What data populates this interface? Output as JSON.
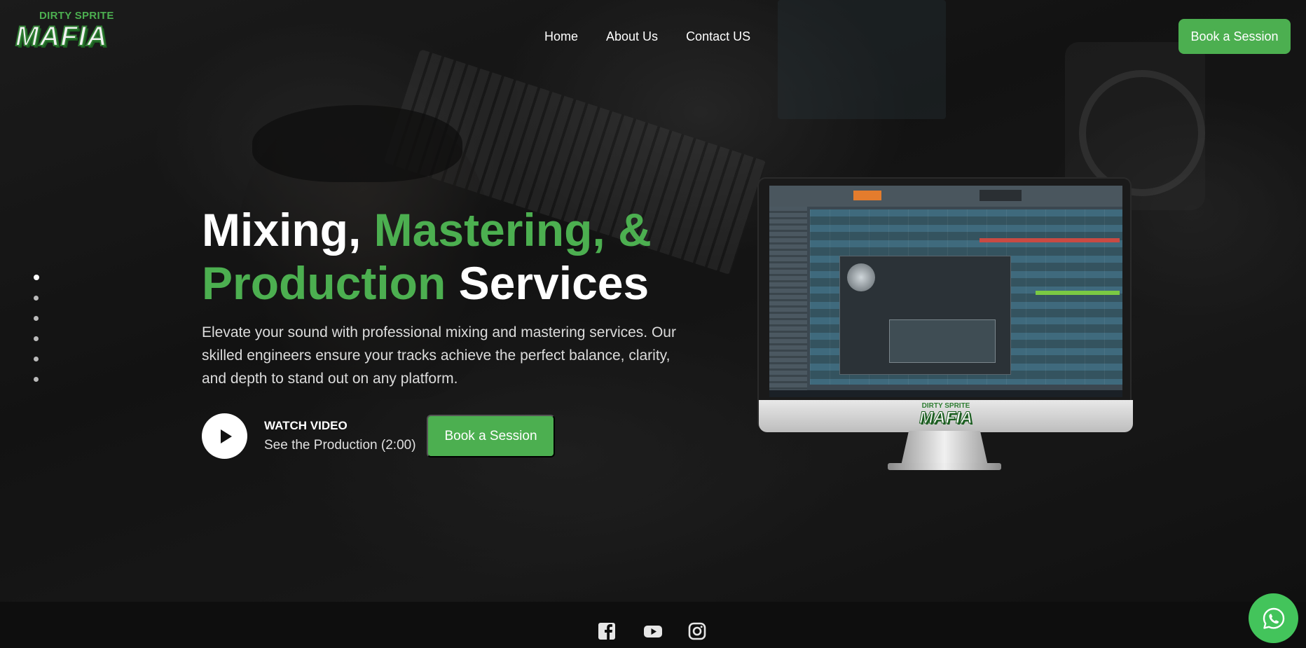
{
  "brand": {
    "logo_top": "DIRTY SPRITE",
    "logo_main": "MAFIA"
  },
  "nav": {
    "items": [
      "Home",
      "About Us",
      "Contact US"
    ]
  },
  "header": {
    "cta_label": "Book a Session"
  },
  "slider": {
    "dot_count": 6,
    "active_index": 0
  },
  "hero": {
    "headline_1": "Mixing, ",
    "headline_2": "Mastering, &",
    "headline_3": "Production",
    "headline_4": " Services",
    "description": "Elevate your sound with professional mixing and mastering services. Our skilled engineers ensure your tracks achieve the perfect balance, clarity, and depth to stand out on any platform.",
    "watch_label": "WATCH VIDEO",
    "watch_sub": "See the Production (2:00)",
    "cta_label": "Book a Session"
  },
  "monitor": {
    "brand_top": "DIRTY SPRITE",
    "brand_main": "MAFIA"
  },
  "footer": {
    "social_icons": [
      "facebook-icon",
      "youtube-icon",
      "instagram-icon"
    ]
  },
  "colors": {
    "accent": "#4CAF50",
    "whatsapp": "#43C45B",
    "footer_bg": "#0E0E0E"
  }
}
